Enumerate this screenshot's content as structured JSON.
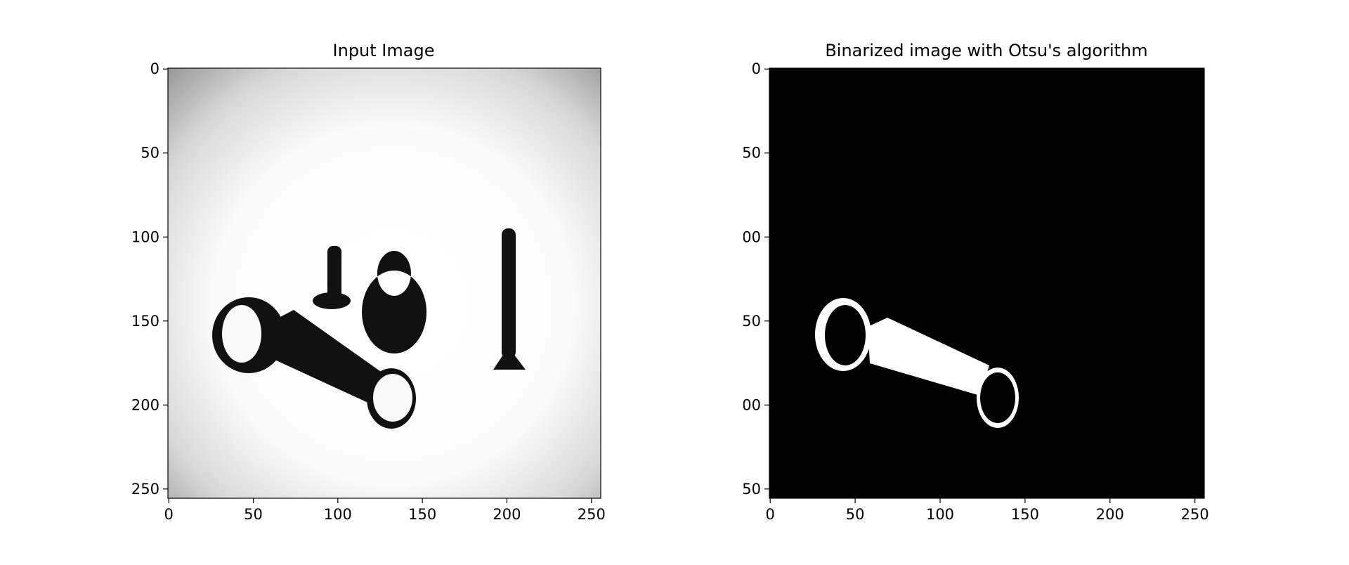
{
  "chart_data": [
    {
      "type": "image",
      "title": "Input Image",
      "x_ticks": [
        0,
        50,
        100,
        150,
        200,
        250
      ],
      "y_ticks": [
        0,
        50,
        100,
        150,
        200,
        250
      ],
      "y_tick_labels": [
        "0",
        "50",
        "100",
        "150",
        "200",
        "250"
      ],
      "xlim": [
        -0.5,
        255.5
      ],
      "ylim": [
        255.5,
        -0.5
      ],
      "colormap": "gray",
      "colors": {
        "background_center": "#ffffff",
        "background_edge": "#9a9a9a",
        "objects": "#111111"
      }
    },
    {
      "type": "image",
      "title": "Binarized image with Otsu's algorithm",
      "x_ticks": [
        0,
        50,
        100,
        150,
        200,
        250
      ],
      "y_ticks": [
        0,
        50,
        100,
        150,
        200,
        250
      ],
      "y_tick_labels": [
        "0",
        "50",
        "00",
        "50",
        "00",
        "50"
      ],
      "xlim": [
        -0.5,
        255.5
      ],
      "ylim": [
        255.5,
        -0.5
      ],
      "colormap": "gray",
      "colors": {
        "background": "#000000",
        "foreground": "#ffffff"
      }
    }
  ]
}
